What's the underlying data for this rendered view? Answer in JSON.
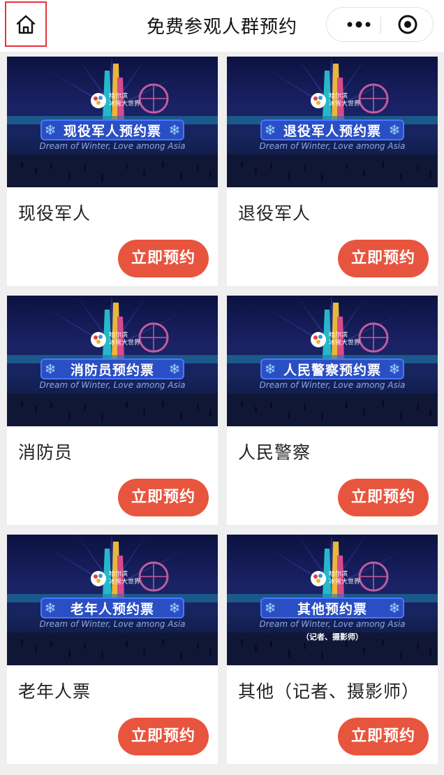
{
  "navbar": {
    "title": "免费参观人群预约",
    "home_icon": "home-icon",
    "more_icon": "more-dots-icon",
    "target_icon": "target-icon",
    "highlight_color": "#e8333a"
  },
  "banner": {
    "logo_line1": "哈尔滨",
    "logo_line2": "冰雪大世界",
    "tagline": "Dream of Winter, Love among Asia"
  },
  "cards": [
    {
      "banner_label": "现役军人预约票",
      "banner_sub": "",
      "title": "现役军人",
      "button": "立即预约"
    },
    {
      "banner_label": "退役军人预约票",
      "banner_sub": "",
      "title": "退役军人",
      "button": "立即预约"
    },
    {
      "banner_label": "消防员预约票",
      "banner_sub": "",
      "title": "消防员",
      "button": "立即预约"
    },
    {
      "banner_label": "人民警察预约票",
      "banner_sub": "",
      "title": "人民警察",
      "button": "立即预约"
    },
    {
      "banner_label": "老年人预约票",
      "banner_sub": "",
      "title": "老年人票",
      "button": "立即预约"
    },
    {
      "banner_label": "其他预约票",
      "banner_sub": "（记者、摄影师）",
      "title": "其他（记者、摄影师）",
      "button": "立即预约"
    }
  ],
  "colors": {
    "button": "#e8553e",
    "ribbon": "#2a4fc4",
    "background": "#efefef"
  }
}
